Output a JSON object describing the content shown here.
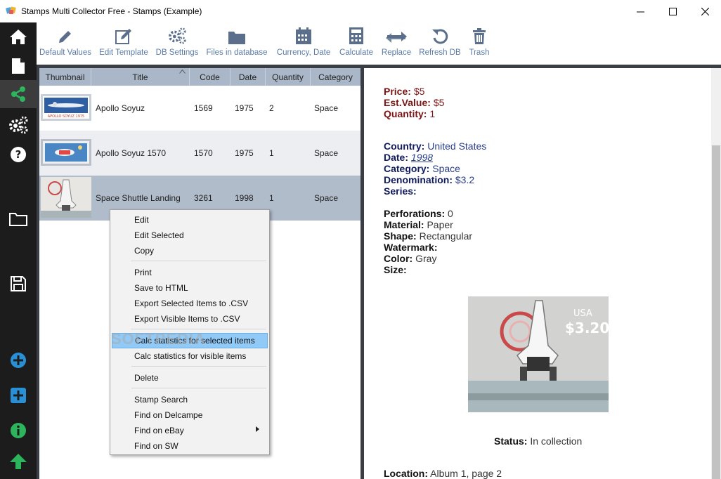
{
  "window": {
    "title": "Stamps Multi Collector Free - Stamps (Example)"
  },
  "sidebar": {
    "items": [
      {
        "icon": "home-icon"
      },
      {
        "icon": "document-icon"
      },
      {
        "icon": "share-icon"
      },
      {
        "icon": "gears-icon"
      },
      {
        "icon": "help-icon"
      },
      {
        "icon": "folder-icon"
      },
      {
        "icon": "save-icon"
      },
      {
        "icon": "add-circle-icon"
      },
      {
        "icon": "add-square-icon"
      },
      {
        "icon": "info-icon"
      },
      {
        "icon": "arrow-up-icon"
      }
    ]
  },
  "toolbar": {
    "items": [
      {
        "label": "Default Values",
        "icon": "pencil-icon"
      },
      {
        "label": "Edit Template",
        "icon": "edit-icon"
      },
      {
        "label": "DB Settings",
        "icon": "gears-icon"
      },
      {
        "label": "Files in database",
        "icon": "folder-icon"
      },
      {
        "label": "Currency, Date",
        "icon": "calendar-icon"
      },
      {
        "label": "Calculate",
        "icon": "calculator-icon"
      },
      {
        "label": "Replace",
        "icon": "replace-icon"
      },
      {
        "label": "Refresh DB",
        "icon": "refresh-icon"
      },
      {
        "label": "Trash",
        "icon": "trash-icon"
      }
    ]
  },
  "grid": {
    "columns": [
      "Thumbnail",
      "Title",
      "Code",
      "Date",
      "Quantity",
      "Category"
    ],
    "rows": [
      {
        "title": "Apollo Soyuz",
        "code": "1569",
        "date": "1975",
        "quantity": "2",
        "category": "Space",
        "thumb_text": "APOLLO SOYUZ 1975"
      },
      {
        "title": "Apollo Soyuz 1570",
        "code": "1570",
        "date": "1975",
        "quantity": "1",
        "category": "Space"
      },
      {
        "title": "Space Shuttle Landing",
        "code": "3261",
        "date": "1998",
        "quantity": "1",
        "category": "Space"
      }
    ]
  },
  "context_menu": {
    "items": [
      "Edit",
      "Edit Selected",
      "Copy",
      "Print",
      "Save to HTML",
      "Export Selected Items to .CSV",
      "Export Visible Items to .CSV",
      "Calc statistics for selected items",
      "Calc statistics for visible items",
      "Delete",
      "Stamp Search",
      "Find on Delcampe",
      "Find on eBay",
      "Find on SW"
    ]
  },
  "watermark": "SOFTPEDIA",
  "details": {
    "price": {
      "label": "Price:",
      "value": "$5"
    },
    "est_value": {
      "label": "Est.Value:",
      "value": "$5"
    },
    "quantity": {
      "label": "Quantity:",
      "value": "1"
    },
    "country": {
      "label": "Country:",
      "value": "United States"
    },
    "date": {
      "label": "Date:",
      "value": "1998"
    },
    "category": {
      "label": "Category:",
      "value": "Space"
    },
    "denomination": {
      "label": "Denomination:",
      "value": "$3.2"
    },
    "series": {
      "label": "Series:",
      "value": ""
    },
    "perforations": {
      "label": "Perforations:",
      "value": "0"
    },
    "material": {
      "label": "Material:",
      "value": "Paper"
    },
    "shape": {
      "label": "Shape:",
      "value": "Rectangular"
    },
    "watermark": {
      "label": "Watermark:",
      "value": ""
    },
    "color": {
      "label": "Color:",
      "value": "Gray"
    },
    "size": {
      "label": "Size:",
      "value": ""
    },
    "stamp_text": {
      "country": "USA",
      "value": "$3.20"
    },
    "status": {
      "label": "Status:",
      "value": "In collection"
    },
    "location": {
      "label": "Location:",
      "value": "Album 1, page 2"
    }
  },
  "colors": {
    "sidebar_bg": "#1c1c1c",
    "header_bg": "#a9b7c8",
    "selected_row": "#b1bccb",
    "alt_row": "#eceef2",
    "toolbar_text": "#5b7ba6",
    "menu_highlight": "#91c9f7",
    "accent_green": "#2db55d",
    "accent_blue": "#2a90d6",
    "brown_label": "#7a1414",
    "navy_label": "#101b5e"
  }
}
